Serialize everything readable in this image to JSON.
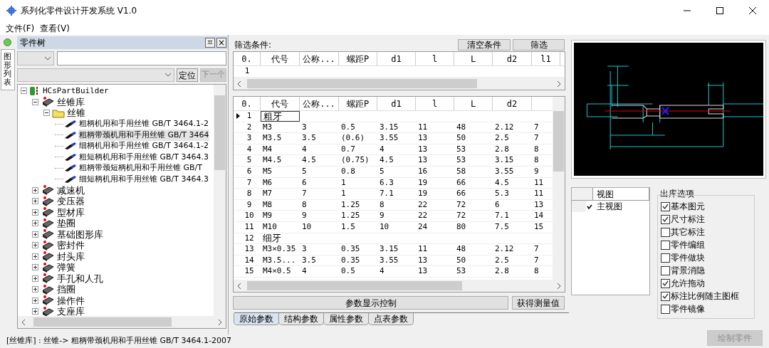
{
  "window": {
    "title": "系列化零件设计开发系统 V1.0"
  },
  "menu": [
    "文件(F)",
    "查看(V)"
  ],
  "side_tab": {
    "label": "图形列表"
  },
  "tree_panel": {
    "title": "零件树",
    "pin": "ㅍ",
    "close": "×",
    "locate_button": "定位",
    "next_button": {
      "label": "下一个",
      "disabled": true
    },
    "tree": [
      {
        "label": "HCsPartBuilder",
        "kind": "root",
        "expanded": true,
        "selected": false,
        "children": [
          {
            "label": "丝锥库",
            "kind": "library",
            "expanded": true,
            "selected": false,
            "children": [
              {
                "label": "丝锥",
                "kind": "folder",
                "expanded": true,
                "selected": false,
                "children": [
                  {
                    "label": "粗柄机用和手用丝锥 GB/T 3464.1-2",
                    "kind": "part",
                    "selected": false
                  },
                  {
                    "label": "粗柄带颈机用和手用丝锥 GB/T 3464",
                    "kind": "part",
                    "selected": true
                  },
                  {
                    "label": "细柄机用和手用丝锥 GB/T 3464.1-2",
                    "kind": "part",
                    "selected": false
                  },
                  {
                    "label": "粗短柄机用和手用丝锥 GB/T 3464.3",
                    "kind": "part",
                    "selected": false
                  },
                  {
                    "label": "粗柄带颈短柄机用和手用丝锥 GB/T",
                    "kind": "part",
                    "selected": false
                  },
                  {
                    "label": "细短柄机用和手用丝锥 GB/T 3464.3",
                    "kind": "part",
                    "selected": false
                  }
                ]
              }
            ]
          },
          {
            "label": "减速机",
            "kind": "library",
            "expanded": false,
            "selected": false
          },
          {
            "label": "变压器",
            "kind": "library",
            "expanded": false,
            "selected": false
          },
          {
            "label": "型材库",
            "kind": "library",
            "expanded": false,
            "selected": false
          },
          {
            "label": "垫圈",
            "kind": "library",
            "expanded": false,
            "selected": false
          },
          {
            "label": "基础图形库",
            "kind": "library",
            "expanded": false,
            "selected": false
          },
          {
            "label": "密封件",
            "kind": "library",
            "expanded": false,
            "selected": false
          },
          {
            "label": "封头库",
            "kind": "library",
            "expanded": false,
            "selected": false
          },
          {
            "label": "弹簧",
            "kind": "library",
            "expanded": false,
            "selected": false
          },
          {
            "label": "手孔和人孔",
            "kind": "library",
            "expanded": false,
            "selected": false
          },
          {
            "label": "挡圈",
            "kind": "library",
            "expanded": false,
            "selected": false
          },
          {
            "label": "操作件",
            "kind": "library",
            "expanded": false,
            "selected": false
          },
          {
            "label": "支座库",
            "kind": "library",
            "expanded": false,
            "selected": false
          }
        ]
      }
    ]
  },
  "filter": {
    "label": "筛选条件:",
    "clear_button": "清空条件",
    "filter_button": "筛选",
    "columns": [
      "0.",
      "代号",
      "公称...",
      "螺距P",
      "d1",
      "l",
      "L",
      "d2",
      "l1"
    ],
    "rows": [
      [
        "1",
        "",
        "",
        "",
        "",
        "",
        "",
        "",
        ""
      ]
    ]
  },
  "param_table": {
    "columns": [
      "0.",
      "代号",
      "公称...",
      "螺距P",
      "d1",
      "l",
      "L",
      "d2",
      ""
    ],
    "rows": [
      {
        "current": true,
        "cells": [
          "1",
          "粗牙",
          "",
          "",
          "",
          "",
          "",
          "",
          ""
        ]
      },
      {
        "current": false,
        "cells": [
          "2",
          "M3",
          "3",
          "0.5",
          "3.15",
          "11",
          "48",
          "2.12",
          "7"
        ]
      },
      {
        "current": false,
        "cells": [
          "3",
          "M3.5",
          "3.5",
          "(0.6)",
          "3.55",
          "13",
          "50",
          "2.5",
          "7"
        ]
      },
      {
        "current": false,
        "cells": [
          "4",
          "M4",
          "4",
          "0.7",
          "4",
          "13",
          "53",
          "2.8",
          "8"
        ]
      },
      {
        "current": false,
        "cells": [
          "5",
          "M4.5",
          "4.5",
          "(0.75)",
          "4.5",
          "13",
          "53",
          "3.15",
          "8"
        ]
      },
      {
        "current": false,
        "cells": [
          "6",
          "M5",
          "5",
          "0.8",
          "5",
          "16",
          "58",
          "3.55",
          "9"
        ]
      },
      {
        "current": false,
        "cells": [
          "7",
          "M6",
          "6",
          "1",
          "6.3",
          "19",
          "66",
          "4.5",
          "11"
        ]
      },
      {
        "current": false,
        "cells": [
          "8",
          "M7",
          "7",
          "1",
          "7.1",
          "19",
          "66",
          "5.3",
          "11"
        ]
      },
      {
        "current": false,
        "cells": [
          "9",
          "M8",
          "8",
          "1.25",
          "8",
          "22",
          "72",
          "6",
          "13"
        ]
      },
      {
        "current": false,
        "cells": [
          "10",
          "M9",
          "9",
          "1.25",
          "9",
          "22",
          "72",
          "7.1",
          "14"
        ]
      },
      {
        "current": false,
        "cells": [
          "11",
          "M10",
          "10",
          "1.5",
          "10",
          "24",
          "80",
          "7.5",
          "15"
        ]
      },
      {
        "current": false,
        "cells": [
          "12",
          "细牙",
          "",
          "",
          "",
          "",
          "",
          "",
          ""
        ]
      },
      {
        "current": false,
        "cells": [
          "13",
          "M3×0.35",
          "3",
          "0.35",
          "3.15",
          "11",
          "48",
          "2.12",
          "7"
        ]
      },
      {
        "current": false,
        "cells": [
          "14",
          "M3.5...",
          "3.5",
          "0.35",
          "3.55",
          "13",
          "50",
          "2.5",
          "7"
        ]
      },
      {
        "current": false,
        "cells": [
          "15",
          "M4×0.5",
          "4",
          "0.5",
          "4",
          "13",
          "53",
          "2.8",
          "8"
        ]
      }
    ]
  },
  "display_control_button": "参数显示控制",
  "measure_button": "获得测量值",
  "tabs": [
    {
      "label": "原始参数",
      "selected": true
    },
    {
      "label": "结构参数",
      "selected": false
    },
    {
      "label": "属性参数",
      "selected": false
    },
    {
      "label": "点表参数",
      "selected": false
    }
  ],
  "views": {
    "header": "视图",
    "items": [
      {
        "label": "主视图",
        "checked": true
      }
    ]
  },
  "export_options": {
    "title": "出库选项",
    "items": [
      {
        "label": "基本图元",
        "checked": true
      },
      {
        "label": "尺寸标注",
        "checked": true
      },
      {
        "label": "其它标注",
        "checked": false
      },
      {
        "label": "零件编组",
        "checked": false
      },
      {
        "label": "零件做块",
        "checked": false
      },
      {
        "label": "背景消隐",
        "checked": false
      },
      {
        "label": "允许拖动",
        "checked": true
      },
      {
        "label": "标注比例随主图框",
        "checked": true
      },
      {
        "label": "零件镜像",
        "checked": false
      }
    ]
  },
  "draw_button": {
    "label": "绘制零件",
    "disabled": true
  },
  "status_bar": {
    "text": "[丝锥库] : 丝锥-> 粗柄带颈机用和手用丝锥 GB/T 3464.1-2007"
  }
}
